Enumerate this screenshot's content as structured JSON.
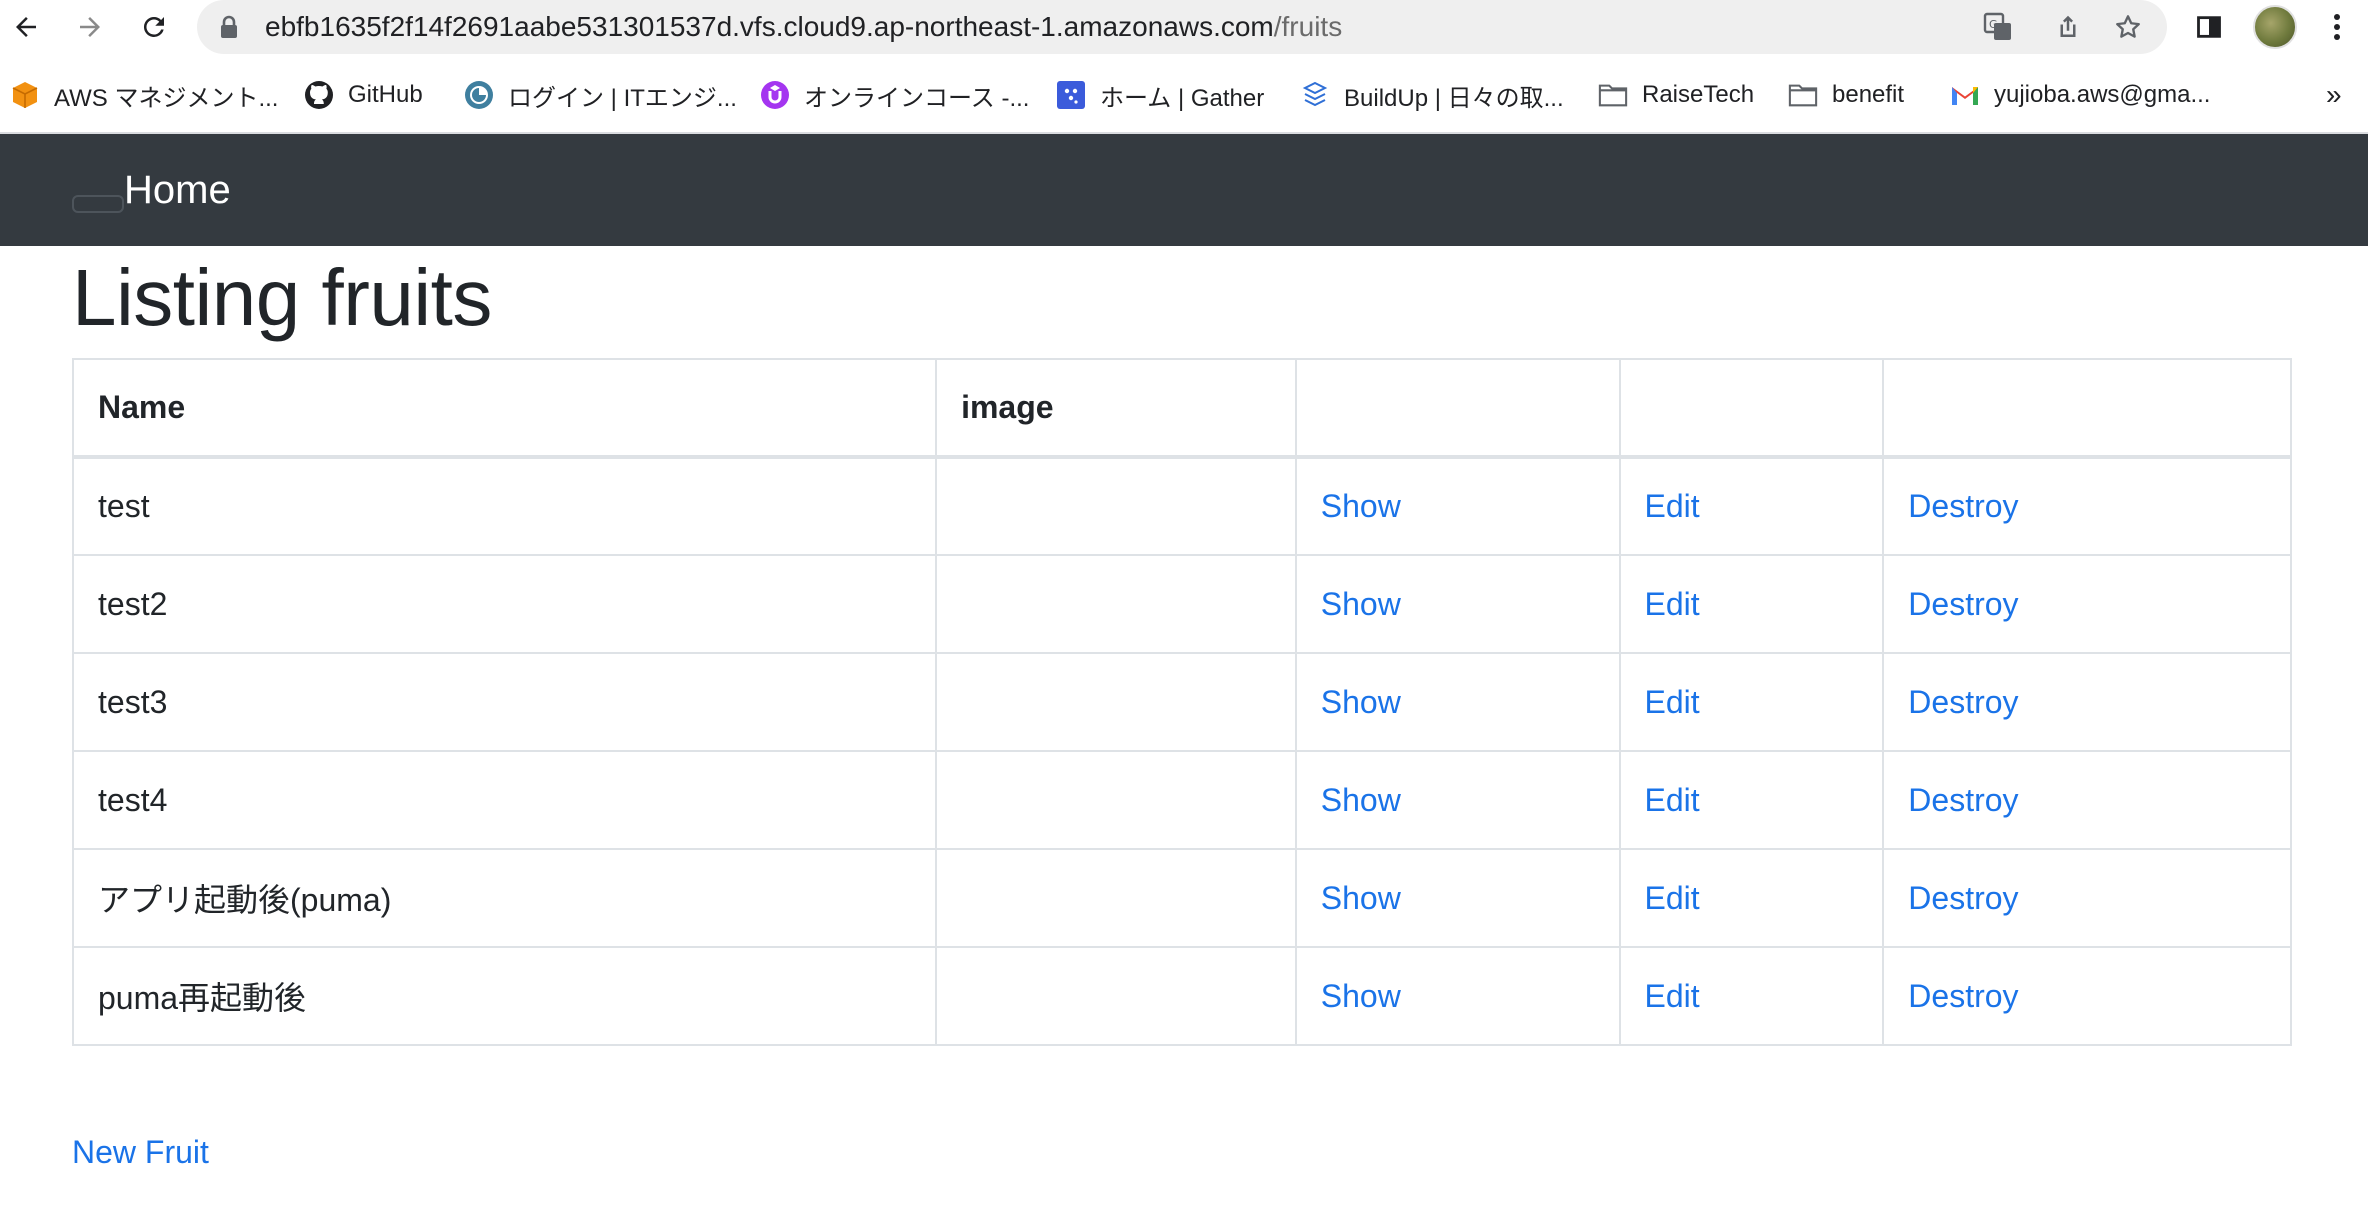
{
  "browser": {
    "url_host": "ebfb1635f2f14f2691aabe531301537d.vfs.cloud9.ap-northeast-1.amazonaws.com",
    "url_path": "/fruits",
    "bookmarks": [
      {
        "label": "AWS マネジメント...",
        "icon": "aws-cube-icon"
      },
      {
        "label": "GitHub",
        "icon": "github-icon"
      },
      {
        "label": "ログイン | ITエンジ...",
        "icon": "login-site-icon"
      },
      {
        "label": "オンラインコース -...",
        "icon": "udemy-icon"
      },
      {
        "label": "ホーム | Gather",
        "icon": "gather-icon"
      },
      {
        "label": "BuildUp | 日々の取...",
        "icon": "buildup-icon"
      },
      {
        "label": "RaiseTech",
        "icon": "folder-icon"
      },
      {
        "label": "benefit",
        "icon": "folder-icon"
      },
      {
        "label": "yujioba.aws@gma...",
        "icon": "gmail-icon"
      }
    ],
    "more_bookmarks": "»"
  },
  "navbar": {
    "brand": "Home"
  },
  "page": {
    "title": "Listing fruits",
    "columns": [
      "Name",
      "image",
      "",
      "",
      ""
    ],
    "rows": [
      {
        "name": "test",
        "image": "",
        "show": "Show",
        "edit": "Edit",
        "destroy": "Destroy"
      },
      {
        "name": "test2",
        "image": "",
        "show": "Show",
        "edit": "Edit",
        "destroy": "Destroy"
      },
      {
        "name": "test3",
        "image": "",
        "show": "Show",
        "edit": "Edit",
        "destroy": "Destroy"
      },
      {
        "name": "test4",
        "image": "",
        "show": "Show",
        "edit": "Edit",
        "destroy": "Destroy"
      },
      {
        "name": "アプリ起動後(puma)",
        "image": "",
        "show": "Show",
        "edit": "Edit",
        "destroy": "Destroy"
      },
      {
        "name": "puma再起動後",
        "image": "",
        "show": "Show",
        "edit": "Edit",
        "destroy": "Destroy"
      }
    ],
    "new_link": "New Fruit"
  },
  "colors": {
    "navbar_bg": "#343a40",
    "link": "#1a73e8",
    "table_border": "#dee2e6"
  }
}
